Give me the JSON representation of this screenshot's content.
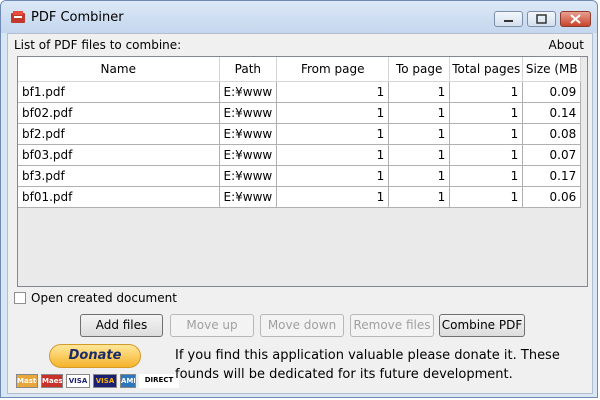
{
  "window": {
    "title": "PDF Combiner"
  },
  "main": {
    "list_label": "List of PDF files to combine:",
    "about": "About"
  },
  "table": {
    "columns": [
      "Name",
      "Path",
      "From page",
      "To page",
      "Total pages",
      "Size (MB"
    ],
    "rows": [
      {
        "name": "bf1.pdf",
        "path": "E:¥www",
        "from": "1",
        "to": "1",
        "total": "1",
        "size": "0.09"
      },
      {
        "name": "bf02.pdf",
        "path": "E:¥www",
        "from": "1",
        "to": "1",
        "total": "1",
        "size": "0.14"
      },
      {
        "name": "bf2.pdf",
        "path": "E:¥www",
        "from": "1",
        "to": "1",
        "total": "1",
        "size": "0.08"
      },
      {
        "name": "bf03.pdf",
        "path": "E:¥www",
        "from": "1",
        "to": "1",
        "total": "1",
        "size": "0.07"
      },
      {
        "name": "bf3.pdf",
        "path": "E:¥www",
        "from": "1",
        "to": "1",
        "total": "1",
        "size": "0.17"
      },
      {
        "name": "bf01.pdf",
        "path": "E:¥www",
        "from": "1",
        "to": "1",
        "total": "1",
        "size": "0.06"
      }
    ]
  },
  "options": {
    "open_created": "Open created document",
    "open_created_checked": false
  },
  "buttons": {
    "add": "Add files",
    "move_up": "Move up",
    "move_down": "Move down",
    "remove": "Remove files",
    "combine": "Combine PDF"
  },
  "donate": {
    "button": "Donate",
    "text": "If you find this application valuable please donate it. These founds will be dedicated for its future development.",
    "cards": [
      "MasterCard",
      "Maestro",
      "VISA",
      "VISA",
      "AMEX",
      "DIRECT Debit"
    ]
  },
  "colors": {
    "title_bar": "#c4d7ee",
    "close_button": "#c7452b",
    "donate": "#f6b32b"
  }
}
